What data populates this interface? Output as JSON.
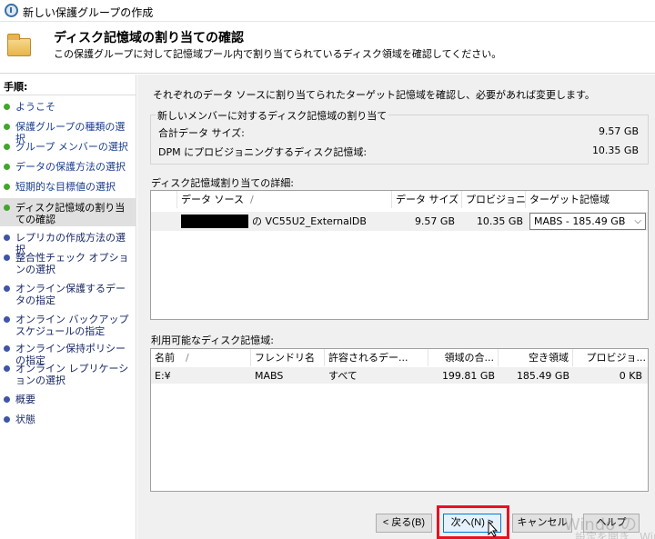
{
  "window": {
    "title": "新しい保護グループの作成"
  },
  "header": {
    "title": "ディスク記憶域の割り当ての確認",
    "subtitle": "この保護グループに対して記憶域プール内で割り当てられているディスク領域を確認してください。"
  },
  "sidebar": {
    "steps_header": "手順:",
    "steps": [
      {
        "label": "ようこそ",
        "state": "done"
      },
      {
        "label": "保護グループの種類の選択",
        "state": "done"
      },
      {
        "label": "グループ メンバーの選択",
        "state": "done"
      },
      {
        "label": "データの保護方法の選択",
        "state": "done"
      },
      {
        "label": "短期的な目標値の選択",
        "state": "done"
      },
      {
        "label": "ディスク記憶域の割り当ての確認",
        "state": "active"
      },
      {
        "label": "レプリカの作成方法の選択",
        "state": "upcoming"
      },
      {
        "label": "整合性チェック オプションの選択",
        "state": "upcoming"
      },
      {
        "label": "オンライン保護するデータの指定",
        "state": "upcoming"
      },
      {
        "label": "オンライン バックアップ スケジュールの指定",
        "state": "upcoming"
      },
      {
        "label": "オンライン保持ポリシーの指定",
        "state": "upcoming"
      },
      {
        "label": "オンライン レプリケーションの選択",
        "state": "upcoming"
      },
      {
        "label": "概要",
        "state": "upcoming"
      },
      {
        "label": "状態",
        "state": "upcoming"
      }
    ]
  },
  "main": {
    "intro": "それぞれのデータ ソースに割り当てられたターゲット記憶域を確認し、必要があれば変更します。",
    "summary": {
      "title": "新しいメンバーに対するディスク記憶域の割り当て",
      "rows": [
        {
          "label": "合計データ サイズ:",
          "value": "9.57 GB"
        },
        {
          "label": "DPM にプロビジョニングするディスク記憶域:",
          "value": "10.35 GB"
        }
      ]
    },
    "details": {
      "title": "ディスク記憶域割り当ての詳細:",
      "columns": [
        "データ ソース",
        "データ サイズ",
        "プロビジョニ...",
        "ターゲット記憶域"
      ],
      "rows": [
        {
          "source_suffix": "の VC55U2_ExternalDB",
          "data_size": "9.57 GB",
          "provisioned": "10.35 GB",
          "target": "MABS - 185.49 GB"
        }
      ]
    },
    "available": {
      "title": "利用可能なディスク記憶域:",
      "columns": [
        "名前",
        "フレンドリ名",
        "許容されるデー...",
        "領域の合...",
        "空き領域",
        "プロビジョ..."
      ],
      "rows": [
        {
          "name": "E:¥",
          "friendly": "MABS",
          "allowed": "すべて",
          "total": "199.81 GB",
          "free": "185.49 GB",
          "provisioned": "0 KB"
        }
      ]
    }
  },
  "buttons": {
    "back": "< 戻る(B)",
    "next": "次へ(N) >",
    "cancel": "キャンセル",
    "help": "ヘルプ"
  },
  "watermark": {
    "line1": "Windo",
    "line1b": "の",
    "line2": "設定を開き、Windo"
  },
  "colors": {
    "done_dot": "#44a52e",
    "upcoming_dot": "#3f54a8",
    "highlight": "#e81123",
    "active_step_bg": "#e0e0e0"
  }
}
